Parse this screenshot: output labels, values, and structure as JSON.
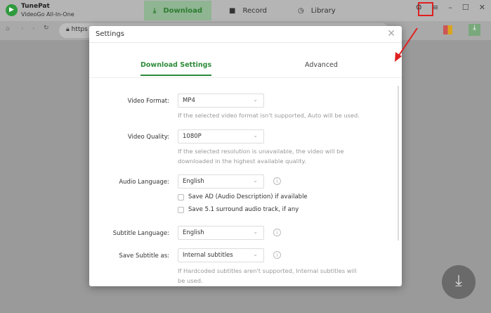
{
  "app": {
    "name": "TunePat",
    "subtitle": "VideoGo All-In-One"
  },
  "nav": {
    "tabs": [
      {
        "label": "Download",
        "active": true
      },
      {
        "label": "Record"
      },
      {
        "label": "Library"
      }
    ]
  },
  "toolbar": {
    "url": "https"
  },
  "accent": "#2e8b3a",
  "annotation_color": "#e02020",
  "settings": {
    "title": "Settings",
    "tabs": [
      {
        "label": "Download Settings",
        "active": true
      },
      {
        "label": "Advanced"
      }
    ],
    "video_format": {
      "label": "Video Format:",
      "value": "MP4",
      "hint": "If the selected video format isn't supported, Auto will be used."
    },
    "video_quality": {
      "label": "Video Quality:",
      "value": "1080P",
      "hint": "If the selected resolution is unavailable, the video will be downloaded in the highest available quality."
    },
    "audio_language": {
      "label": "Audio Language:",
      "value": "English"
    },
    "save_ad": {
      "label": "Save AD (Audio Description) if available",
      "checked": false
    },
    "save_51": {
      "label": "Save 5.1 surround audio track, if any",
      "checked": false
    },
    "subtitle_language": {
      "label": "Subtitle Language:",
      "value": "English"
    },
    "save_subtitle_as": {
      "label": "Save Subtitle as:",
      "value": "Internal subtitles",
      "hint": "If Hardcoded subtitles aren't supported, Internal subtitles will be used."
    }
  }
}
